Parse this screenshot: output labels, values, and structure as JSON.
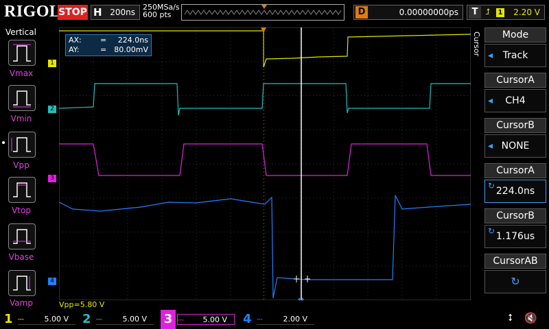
{
  "topbar": {
    "logo": "RIGOL",
    "run_state": "STOP",
    "timebase_label": "H",
    "timebase_value": "200ns",
    "sample_rate": "250MSa/s",
    "memory_depth": "600 pts",
    "delay_label": "D",
    "delay_value": "0.00000000ps",
    "trigger_label": "T",
    "trigger_icon": "rising-edge-icon",
    "trigger_source": "1",
    "trigger_level": "2.20 V"
  },
  "left_panel": {
    "title": "Vertical",
    "items": [
      {
        "label": "Vmax"
      },
      {
        "label": "Vmin"
      },
      {
        "label": "Vpp"
      },
      {
        "label": "Vtop"
      },
      {
        "label": "Vbase"
      },
      {
        "label": "Vamp"
      }
    ]
  },
  "cursor_readout": {
    "ax_label": "AX:",
    "ax_eq": "=",
    "ax_value": "224.0ns",
    "ay_label": "AY:",
    "ay_eq": "=",
    "ay_value": "80.00mV"
  },
  "measurement": {
    "vpp": "Vpp=5.80 V"
  },
  "right_menu": {
    "vertical_label": "Cursor",
    "items": [
      {
        "title": "Mode",
        "value": "Track"
      },
      {
        "title": "CursorA",
        "value": "CH4"
      },
      {
        "title": "CursorB",
        "value": "NONE"
      },
      {
        "title": "CursorA",
        "value": "224.0ns"
      },
      {
        "title": "CursorB",
        "value": "1.176us"
      },
      {
        "title": "CursorAB",
        "value": ""
      }
    ]
  },
  "channels": [
    {
      "num": "1",
      "scale": "5.00 V",
      "color": "#e6e600"
    },
    {
      "num": "2",
      "scale": "5.00 V",
      "color": "#20c0c0"
    },
    {
      "num": "3",
      "scale": "5.00 V",
      "color": "#e020e0"
    },
    {
      "num": "4",
      "scale": "2.00 V",
      "color": "#2080ff"
    }
  ],
  "colors": {
    "ch1": "#e6e600",
    "ch2": "#20c0c0",
    "ch3": "#e020e0",
    "ch4": "#2080ff",
    "stop": "#e02020",
    "delay": "#e07a10",
    "accent": "#3aa0ff"
  },
  "icons": {
    "usb": "usb-icon",
    "speaker": "speaker-mute-icon"
  }
}
